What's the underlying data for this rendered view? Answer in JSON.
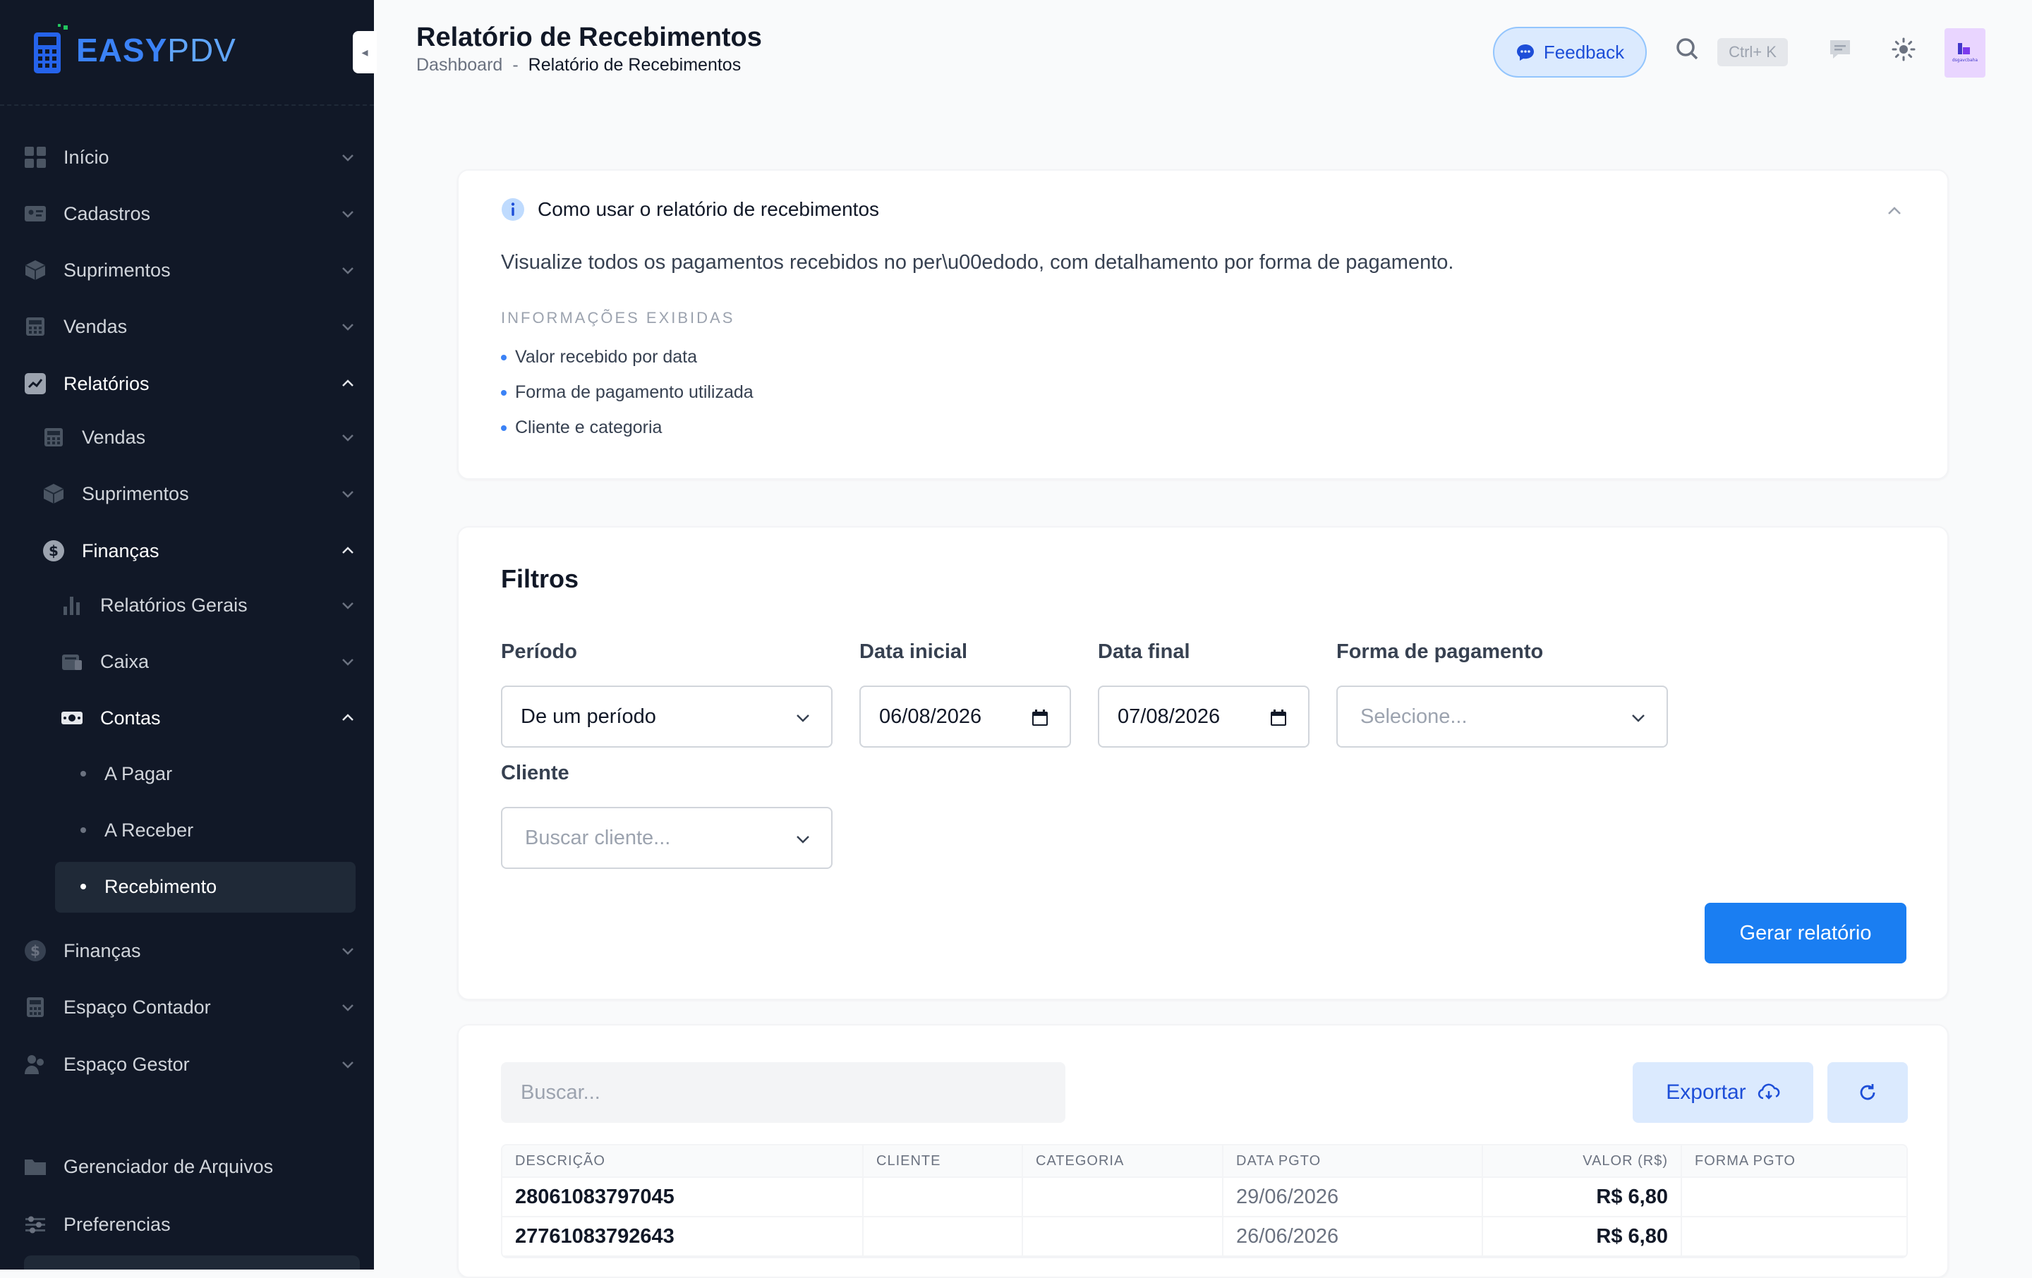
{
  "brand": {
    "name_bold": "EASY",
    "name_light": "PDV"
  },
  "sidebar": {
    "items": [
      {
        "label": "Início",
        "icon": "home-icon"
      },
      {
        "label": "Cadastros",
        "icon": "id-card-icon"
      },
      {
        "label": "Suprimentos",
        "icon": "box-icon"
      },
      {
        "label": "Vendas",
        "icon": "register-icon"
      },
      {
        "label": "Relatórios",
        "icon": "chart-icon"
      },
      {
        "label": "Vendas",
        "icon": "register-icon"
      },
      {
        "label": "Suprimentos",
        "icon": "box-icon"
      },
      {
        "label": "Finanças",
        "icon": "dollar-icon"
      },
      {
        "label": "Relatórios Gerais",
        "icon": "bar-chart-icon"
      },
      {
        "label": "Caixa",
        "icon": "cash-drawer-icon"
      },
      {
        "label": "Contas",
        "icon": "money-icon"
      },
      {
        "label": "A Pagar"
      },
      {
        "label": "A Receber"
      },
      {
        "label": "Recebimento"
      },
      {
        "label": "Finanças",
        "icon": "dollar-icon"
      },
      {
        "label": "Espaço Contador",
        "icon": "calculator-icon"
      },
      {
        "label": "Espaço Gestor",
        "icon": "users-icon"
      },
      {
        "label": "Gerenciador de Arquivos",
        "icon": "folder-icon"
      },
      {
        "label": "Preferencias",
        "icon": "sliders-icon"
      }
    ]
  },
  "header": {
    "title": "Relatório de Recebimentos",
    "breadcrumb": {
      "parent": "Dashboard",
      "separator": "-",
      "current": "Relatório de Recebimentos"
    },
    "feedback_label": "Feedback",
    "shortcut": "Ctrl+ K",
    "avatar_text": "dsgavcbaha"
  },
  "info": {
    "title": "Como usar o relatório de recebimentos",
    "description": "Visualize todos os pagamentos recebidos no per\\u00edodo, com detalhamento por forma de pagamento.",
    "subtitle": "INFORMAÇÕES EXIBIDAS",
    "bullets": [
      "Valor recebido por data",
      "Forma de pagamento utilizada",
      "Cliente e categoria"
    ]
  },
  "filters": {
    "title": "Filtros",
    "periodo_label": "Período",
    "periodo_value": "De um período",
    "data_inicial_label": "Data inicial",
    "data_inicial_value": "06/08/2026",
    "data_final_label": "Data final",
    "data_final_value": "07/08/2026",
    "forma_label": "Forma de pagamento",
    "forma_placeholder": "Selecione...",
    "cliente_label": "Cliente",
    "cliente_placeholder": "Buscar cliente...",
    "generate_label": "Gerar relatório"
  },
  "results": {
    "search_placeholder": "Buscar...",
    "export_label": "Exportar",
    "columns": [
      "DESCRIÇÃO",
      "CLIENTE",
      "CATEGORIA",
      "DATA PGTO",
      "VALOR (R$)",
      "FORMA PGTO"
    ],
    "rows": [
      [
        "28061083797045",
        "",
        "",
        "29/06/2026",
        "R$ 6,80",
        ""
      ],
      [
        "27761083792643",
        "",
        "",
        "26/06/2026",
        "R$ 6,80",
        ""
      ]
    ]
  },
  "colors": {
    "sidebar_bg": "#111827",
    "accent": "#1a7ef2",
    "feedback_bg": "#dbeafe"
  }
}
